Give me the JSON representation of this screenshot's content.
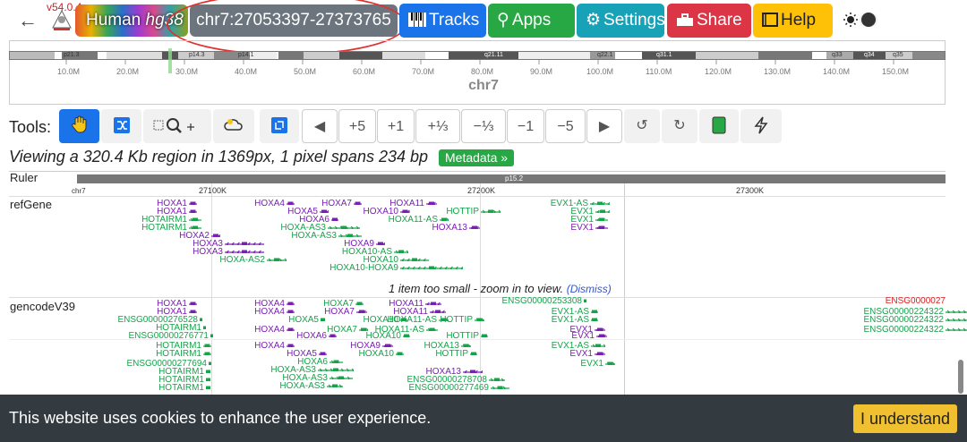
{
  "header": {
    "version": "v54.0.4",
    "genome_name": "Human",
    "genome_assembly": "hg38",
    "locus": "chr7:27053397-27373765",
    "buttons": {
      "tracks": "Tracks",
      "apps": "Apps",
      "settings": "Settings",
      "share": "Share",
      "help": "Help"
    },
    "colors": {
      "tracks": "#1a73e8",
      "apps": "#28a745",
      "settings": "#17a2b8",
      "share": "#dc3545",
      "help": "#ffc107"
    }
  },
  "chromosome": {
    "name": "chr7",
    "band_labels": [
      "p21.3",
      "p14.3",
      "p14.1",
      "q21.11",
      "q22.1",
      "q31.1",
      "q33",
      "q34",
      "q35"
    ],
    "scale_ticks": [
      "10.0M",
      "20.0M",
      "30.0M",
      "40.0M",
      "50.0M",
      "60.0M",
      "70.0M",
      "80.0M",
      "90.0M",
      "100.0M",
      "110.0M",
      "120.0M",
      "130.0M",
      "140.0M",
      "150.0M"
    ]
  },
  "tools": {
    "label": "Tools:",
    "zoom_buttons": [
      "+5",
      "+1",
      "+⅓",
      "−⅓",
      "−1",
      "−5"
    ]
  },
  "viewing": {
    "text": "Viewing a 320.4 Kb region in 1369px, 1 pixel spans 234 bp",
    "metadata_button": "Metadata »"
  },
  "tracks": {
    "ruler": {
      "name": "Ruler",
      "band": "p15.2",
      "chr": "chr7",
      "ticks": [
        "27100K",
        "27200K",
        "27300K"
      ]
    },
    "refGene": {
      "name": "refGene",
      "genes": [
        {
          "label": "HOXA1",
          "color": "pur"
        },
        {
          "label": "HOXA1",
          "color": "pur"
        },
        {
          "label": "HOTAIRM1",
          "color": "grn"
        },
        {
          "label": "HOTAIRM1",
          "color": "grn"
        },
        {
          "label": "HOXA2",
          "color": "pur"
        },
        {
          "label": "HOXA3",
          "color": "pur"
        },
        {
          "label": "HOXA3",
          "color": "pur"
        },
        {
          "label": "HOXA-AS2",
          "color": "grn"
        },
        {
          "label": "HOXA4",
          "color": "pur"
        },
        {
          "label": "HOXA5",
          "color": "pur"
        },
        {
          "label": "HOXA6",
          "color": "pur"
        },
        {
          "label": "HOXA-AS3",
          "color": "grn"
        },
        {
          "label": "HOXA-AS3",
          "color": "grn"
        },
        {
          "label": "HOXA7",
          "color": "pur"
        },
        {
          "label": "HOXA10",
          "color": "pur"
        },
        {
          "label": "HOXA9",
          "color": "pur"
        },
        {
          "label": "HOXA10-AS",
          "color": "grn"
        },
        {
          "label": "HOXA10",
          "color": "grn"
        },
        {
          "label": "HOXA10-HOXA9",
          "color": "grn"
        },
        {
          "label": "HOXA11",
          "color": "pur"
        },
        {
          "label": "HOXA11-AS",
          "color": "grn"
        },
        {
          "label": "HOTTIP",
          "color": "grn"
        },
        {
          "label": "HOXA13",
          "color": "pur"
        },
        {
          "label": "EVX1-AS",
          "color": "grn"
        },
        {
          "label": "EVX1",
          "color": "grn"
        },
        {
          "label": "EVX1",
          "color": "grn"
        },
        {
          "label": "EVX1",
          "color": "pur"
        }
      ],
      "message": "1 item too small - zoom in to view.",
      "dismiss": "(Dismiss)"
    },
    "gencode": {
      "name": "gencodeV39",
      "genes": [
        {
          "label": "HOXA1",
          "color": "pur"
        },
        {
          "label": "HOXA1",
          "color": "pur"
        },
        {
          "label": "ENSG00000276528",
          "color": "grn"
        },
        {
          "label": "HOTAIRM1",
          "color": "grn"
        },
        {
          "label": "ENSG00000276771",
          "color": "grn"
        },
        {
          "label": "HOTAIRM1",
          "color": "grn"
        },
        {
          "label": "HOTAIRM1",
          "color": "grn"
        },
        {
          "label": "ENSG00000277694",
          "color": "grn"
        },
        {
          "label": "HOTAIRM1",
          "color": "grn"
        },
        {
          "label": "HOTAIRM1",
          "color": "grn"
        },
        {
          "label": "HOTAIRM1",
          "color": "grn"
        },
        {
          "label": "HOXA4",
          "color": "pur"
        },
        {
          "label": "HOXA4",
          "color": "pur"
        },
        {
          "label": "HOXA5",
          "color": "grn"
        },
        {
          "label": "HOXA4",
          "color": "pur"
        },
        {
          "label": "HOXA6",
          "color": "pur"
        },
        {
          "label": "HOXA4",
          "color": "pur"
        },
        {
          "label": "HOXA5",
          "color": "pur"
        },
        {
          "label": "HOXA6",
          "color": "grn"
        },
        {
          "label": "HOXA-AS3",
          "color": "grn"
        },
        {
          "label": "HOXA-AS3",
          "color": "grn"
        },
        {
          "label": "HOXA-AS3",
          "color": "grn"
        },
        {
          "label": "HOXA7",
          "color": "grn"
        },
        {
          "label": "HOXA7",
          "color": "pur"
        },
        {
          "label": "HOXA7",
          "color": "grn"
        },
        {
          "label": "HOXA9",
          "color": "pur"
        },
        {
          "label": "HOXA10",
          "color": "grn"
        },
        {
          "label": "HOXA10",
          "color": "grn"
        },
        {
          "label": "HOXA10",
          "color": "grn"
        },
        {
          "label": "HOXA11",
          "color": "pur"
        },
        {
          "label": "HOXA11",
          "color": "pur"
        },
        {
          "label": "HOXA11-AS",
          "color": "grn"
        },
        {
          "label": "HOXA11-AS",
          "color": "grn"
        },
        {
          "label": "HOTTIP",
          "color": "grn"
        },
        {
          "label": "HOTTIP",
          "color": "grn"
        },
        {
          "label": "HOXA13",
          "color": "grn"
        },
        {
          "label": "HOTTIP",
          "color": "grn"
        },
        {
          "label": "HOXA13",
          "color": "pur"
        },
        {
          "label": "ENSG00000278708",
          "color": "grn"
        },
        {
          "label": "ENSG00000277469",
          "color": "grn"
        },
        {
          "label": "ENSG00000253308",
          "color": "grn"
        },
        {
          "label": "EVX1-AS",
          "color": "grn"
        },
        {
          "label": "EVX1-AS",
          "color": "grn"
        },
        {
          "label": "EVX1",
          "color": "pur"
        },
        {
          "label": "EVX1",
          "color": "pur"
        },
        {
          "label": "EVX1-AS",
          "color": "grn"
        },
        {
          "label": "EVX1",
          "color": "pur"
        },
        {
          "label": "EVX1",
          "color": "grn"
        },
        {
          "label": "ENSG0000027",
          "color": "red"
        },
        {
          "label": "ENSG00000224322",
          "color": "grn"
        },
        {
          "label": "ENSG00000224322",
          "color": "grn"
        },
        {
          "label": "ENSG00000224322",
          "color": "grn"
        }
      ]
    }
  },
  "cookie": {
    "text": "This website uses cookies to enhance the user experience.",
    "button": "I understand"
  }
}
